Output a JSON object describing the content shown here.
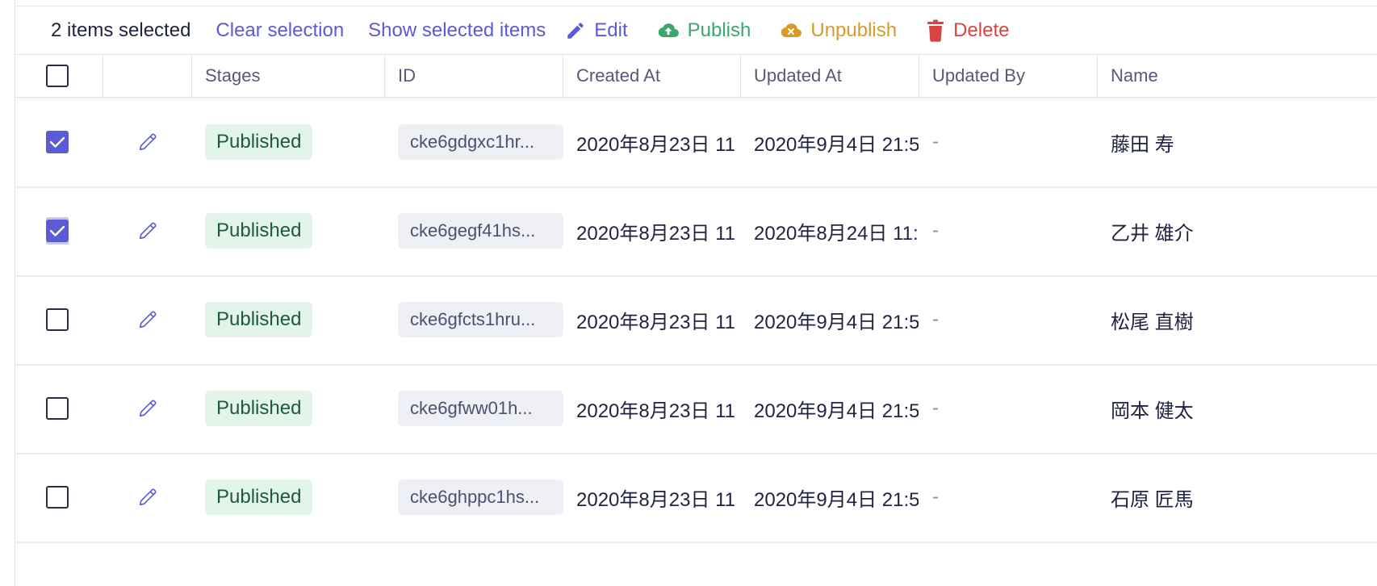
{
  "toolbar": {
    "selected_count": "2 items selected",
    "clear_selection": "Clear selection",
    "show_selected": "Show selected items",
    "edit": "Edit",
    "publish": "Publish",
    "unpublish": "Unpublish",
    "delete": "Delete"
  },
  "colors": {
    "accent": "#5b5bd6",
    "publish": "#3aa76d",
    "unpublish": "#d99a29",
    "delete": "#d64545",
    "badge_bg": "#e3f5ea"
  },
  "columns": {
    "stages": "Stages",
    "id": "ID",
    "created_at": "Created At",
    "updated_at": "Updated At",
    "updated_by": "Updated By",
    "name": "Name"
  },
  "rows": [
    {
      "checked": true,
      "stage": "Published",
      "id": "cke6gdgxc1hr...",
      "created_at": "2020年8月23日 11",
      "updated_at": "2020年9月4日 21:5",
      "updated_by": "-",
      "name": "藤田 寿"
    },
    {
      "checked": true,
      "stage": "Published",
      "id": "cke6gegf41hs...",
      "created_at": "2020年8月23日 11",
      "updated_at": "2020年8月24日 11:",
      "updated_by": "-",
      "name": "乙井 雄介"
    },
    {
      "checked": false,
      "stage": "Published",
      "id": "cke6gfcts1hru...",
      "created_at": "2020年8月23日 11",
      "updated_at": "2020年9月4日 21:5",
      "updated_by": "-",
      "name": "松尾 直樹"
    },
    {
      "checked": false,
      "stage": "Published",
      "id": "cke6gfww01h...",
      "created_at": "2020年8月23日 11",
      "updated_at": "2020年9月4日 21:5",
      "updated_by": "-",
      "name": "岡本 健太"
    },
    {
      "checked": false,
      "stage": "Published",
      "id": "cke6ghppc1hs...",
      "created_at": "2020年8月23日 11",
      "updated_at": "2020年9月4日 21:5",
      "updated_by": "-",
      "name": "石原 匠馬"
    }
  ]
}
